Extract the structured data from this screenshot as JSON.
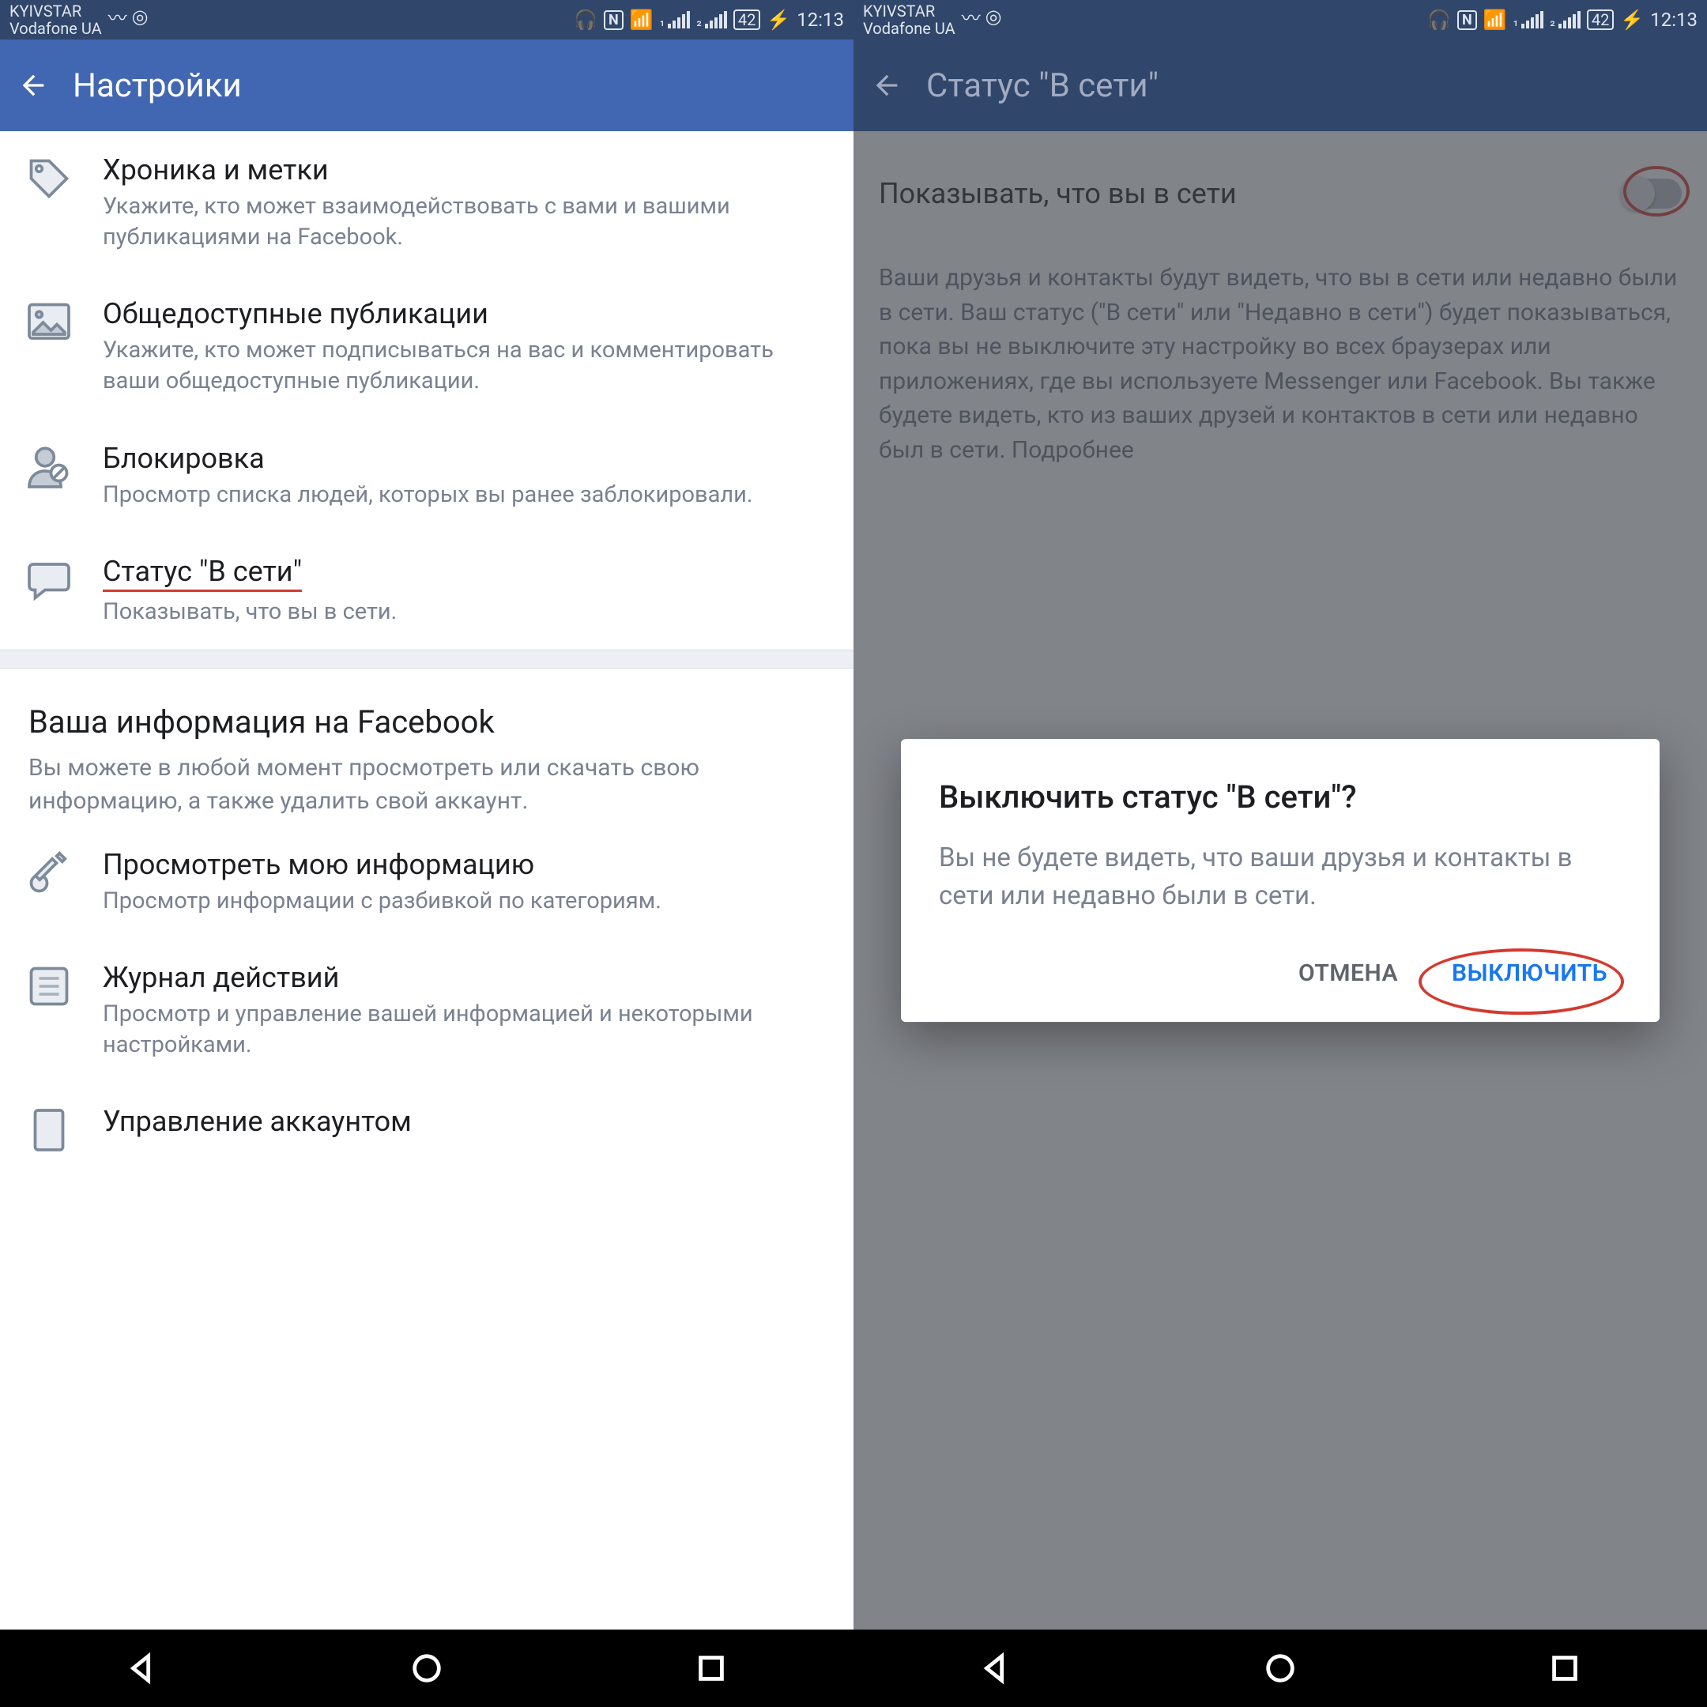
{
  "statusbar": {
    "carrier_line1": "KYIVSTAR",
    "carrier_line2": "Vodafone UA",
    "battery": "42",
    "time": "12:13"
  },
  "left": {
    "appbar_title": "Настройки",
    "items": [
      {
        "title": "Хроника и метки",
        "sub": "Укажите, кто может взаимодействовать с вами и вашими публикациями на Facebook."
      },
      {
        "title": "Общедоступные публикации",
        "sub": "Укажите, кто может подписываться на вас и комментировать ваши общедоступные публикации."
      },
      {
        "title": "Блокировка",
        "sub": "Просмотр списка людей, которых вы ранее заблокировали."
      },
      {
        "title": "Статус \"В сети\"",
        "sub": "Показывать, что вы в сети."
      }
    ],
    "section_title": "Ваша информация на Facebook",
    "section_sub": "Вы можете в любой момент просмотреть или скачать свою информацию, а также удалить свой аккаунт.",
    "items2": [
      {
        "title": "Просмотреть мою информацию",
        "sub": "Просмотр информации с разбивкой по категориям."
      },
      {
        "title": "Журнал действий",
        "sub": "Просмотр и управление вашей информацией и некоторыми настройками."
      },
      {
        "title": "Управление аккаунтом",
        "sub": ""
      }
    ]
  },
  "right": {
    "appbar_title": "Статус \"В сети\"",
    "toggle_label": "Показывать, что вы в сети",
    "desc": "Ваши друзья и контакты будут видеть, что вы в сети или недавно были в сети. Ваш статус (\"В сети\" или \"Недавно в сети\") будет показываться, пока вы не выключите эту настройку во всех браузерах или приложениях, где вы используете Messenger или Facebook. Вы также будете видеть, кто из ваших друзей и контактов в сети или недавно был в сети. Подробнее",
    "dialog": {
      "title": "Выключить статус \"В сети\"?",
      "body": "Вы не будете видеть, что ваши друзья и контакты в сети или недавно были в сети.",
      "cancel": "ОТМЕНА",
      "confirm": "ВЫКЛЮЧИТЬ"
    }
  }
}
